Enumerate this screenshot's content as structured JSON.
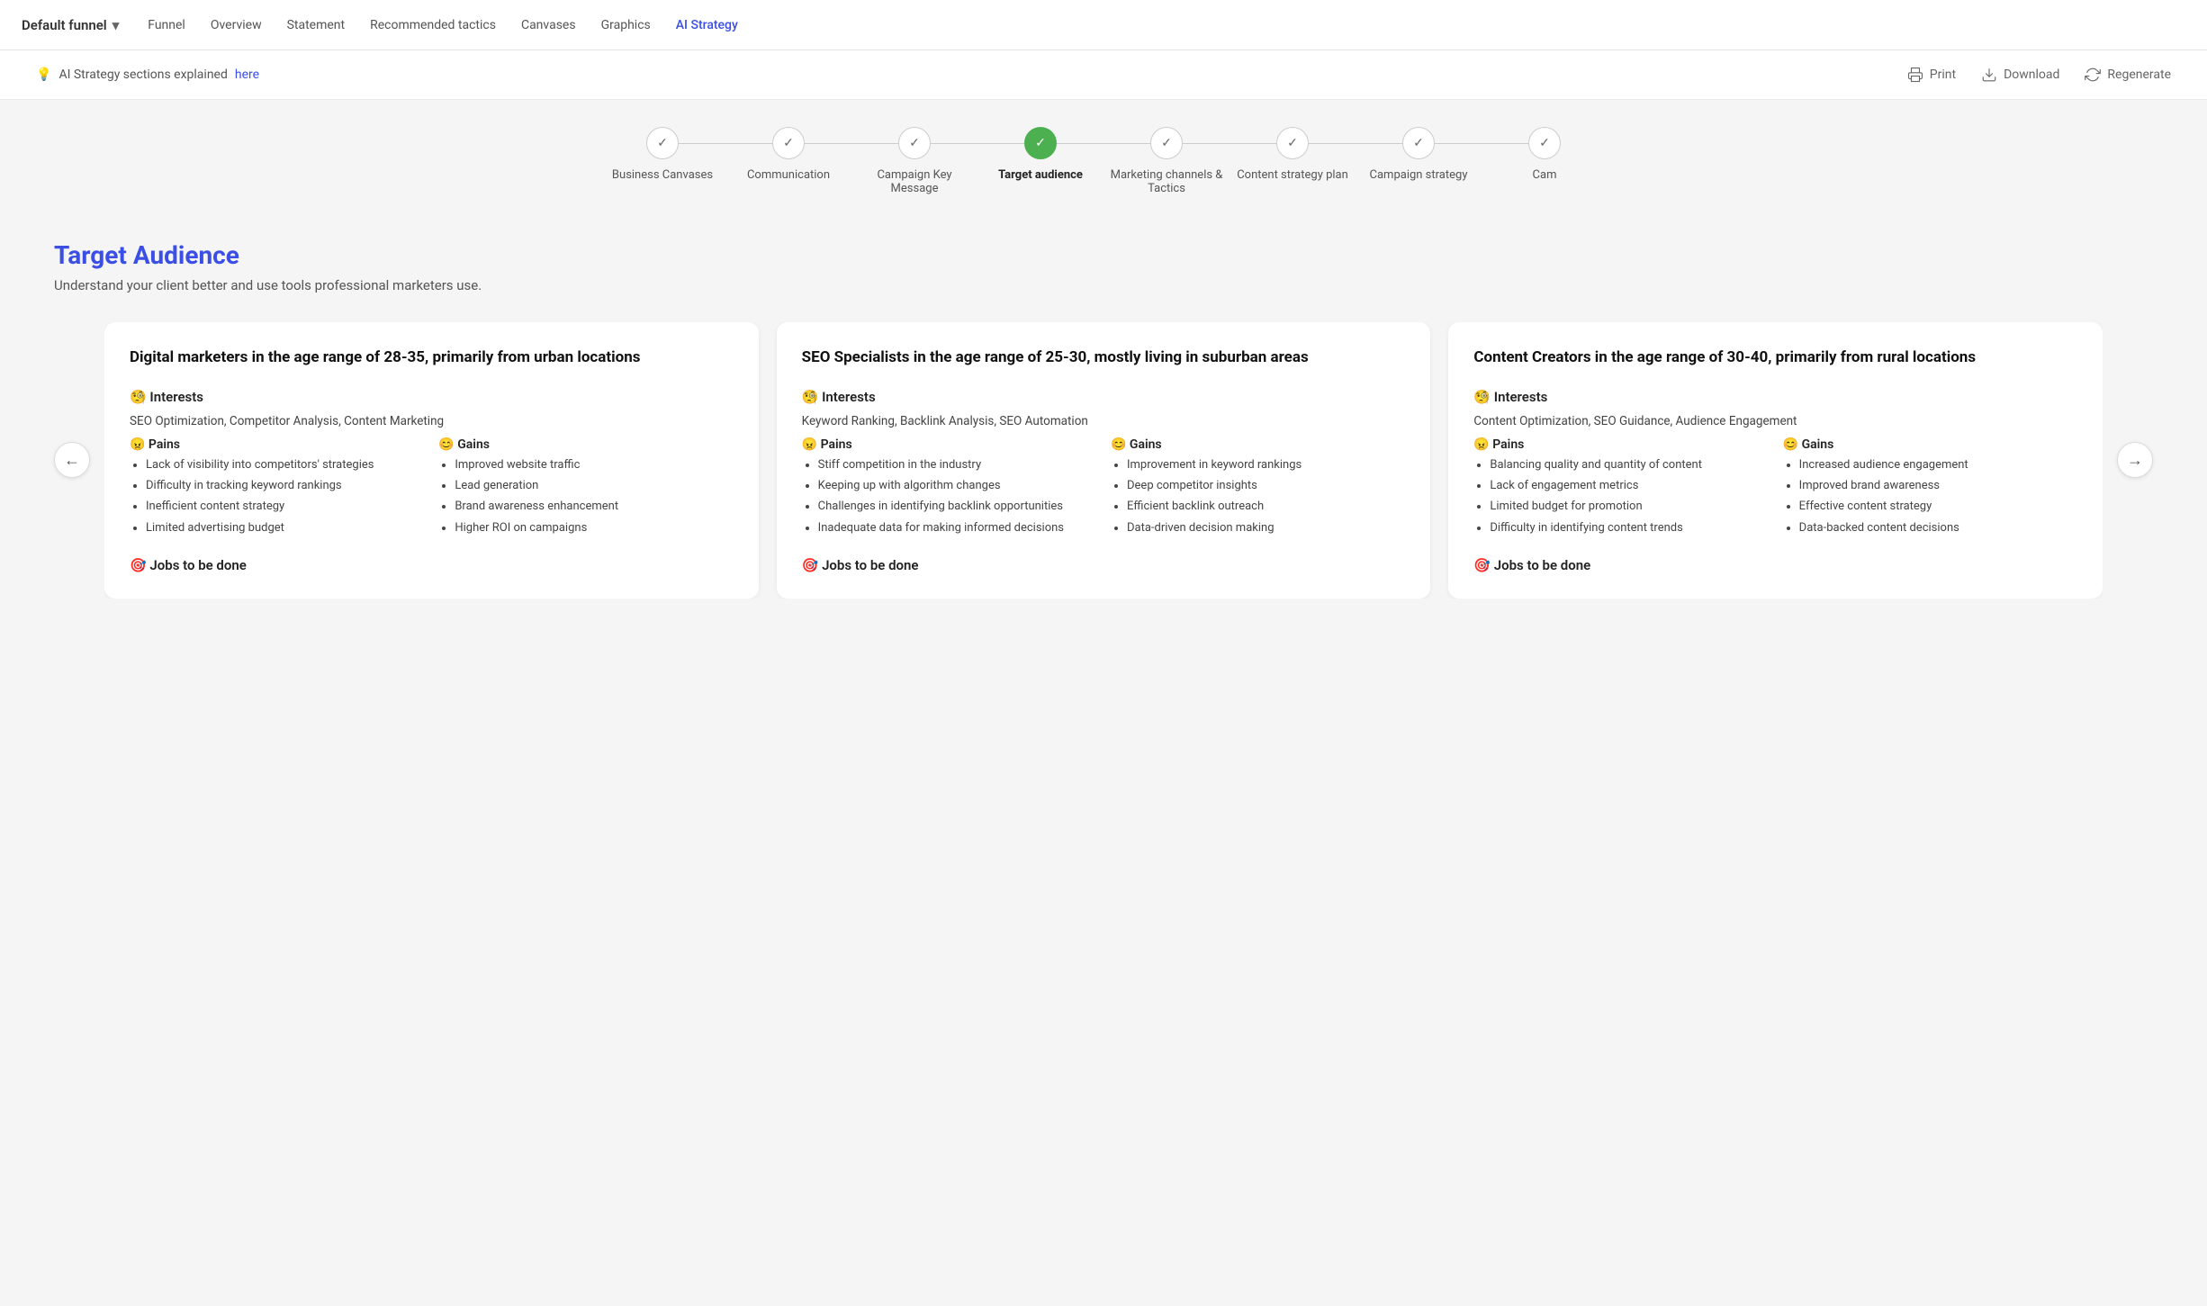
{
  "nav": {
    "funnel_name": "Default funnel",
    "links": [
      {
        "label": "Funnel",
        "active": false
      },
      {
        "label": "Overview",
        "active": false
      },
      {
        "label": "Statement",
        "active": false
      },
      {
        "label": "Recommended tactics",
        "active": false
      },
      {
        "label": "Canvases",
        "active": false
      },
      {
        "label": "Graphics",
        "active": false
      },
      {
        "label": "AI Strategy",
        "active": true
      }
    ]
  },
  "action_bar": {
    "info_text": "AI Strategy sections explained",
    "info_link": "here",
    "print_label": "Print",
    "download_label": "Download",
    "regenerate_label": "Regenerate"
  },
  "stepper": {
    "items": [
      {
        "label": "Business Canvases",
        "active": false
      },
      {
        "label": "Communication",
        "active": false
      },
      {
        "label": "Campaign Key Message",
        "active": false
      },
      {
        "label": "Target audience",
        "active": true
      },
      {
        "label": "Marketing channels & Tactics",
        "active": false
      },
      {
        "label": "Content strategy plan",
        "active": false
      },
      {
        "label": "Campaign strategy",
        "active": false
      },
      {
        "label": "Cam",
        "active": false
      }
    ]
  },
  "section": {
    "title": "Target Audience",
    "subtitle": "Understand your client better and use tools professional marketers use."
  },
  "cards": [
    {
      "title": "Digital marketers in the age range of 28-35, primarily from urban locations",
      "interests_label": "🧐 Interests",
      "interests_text": "SEO Optimization, Competitor Analysis, Content Marketing",
      "pains_label": "😠 Pains",
      "gains_label": "😊 Gains",
      "pains": [
        "Lack of visibility into competitors' strategies",
        "Difficulty in tracking keyword rankings",
        "Inefficient content strategy",
        "Limited advertising budget"
      ],
      "gains": [
        "Improved website traffic",
        "Lead generation",
        "Brand awareness enhancement",
        "Higher ROI on campaigns"
      ],
      "jobs_label": "🎯 Jobs to be done"
    },
    {
      "title": "SEO Specialists in the age range of 25-30, mostly living in suburban areas",
      "interests_label": "🧐 Interests",
      "interests_text": "Keyword Ranking, Backlink Analysis, SEO Automation",
      "pains_label": "😠 Pains",
      "gains_label": "😊 Gains",
      "pains": [
        "Stiff competition in the industry",
        "Keeping up with algorithm changes",
        "Challenges in identifying backlink opportunities",
        "Inadequate data for making informed decisions"
      ],
      "gains": [
        "Improvement in keyword rankings",
        "Deep competitor insights",
        "Efficient backlink outreach",
        "Data-driven decision making"
      ],
      "jobs_label": "🎯 Jobs to be done"
    },
    {
      "title": "Content Creators in the age range of 30-40, primarily from rural locations",
      "interests_label": "🧐 Interests",
      "interests_text": "Content Optimization, SEO Guidance, Audience Engagement",
      "pains_label": "😠 Pains",
      "gains_label": "😊 Gains",
      "pains": [
        "Balancing quality and quantity of content",
        "Lack of engagement metrics",
        "Limited budget for promotion",
        "Difficulty in identifying content trends"
      ],
      "gains": [
        "Increased audience engagement",
        "Improved brand awareness",
        "Effective content strategy",
        "Data-backed content decisions"
      ],
      "jobs_label": "🎯 Jobs to be done"
    }
  ],
  "arrows": {
    "left": "←",
    "right": "→"
  }
}
